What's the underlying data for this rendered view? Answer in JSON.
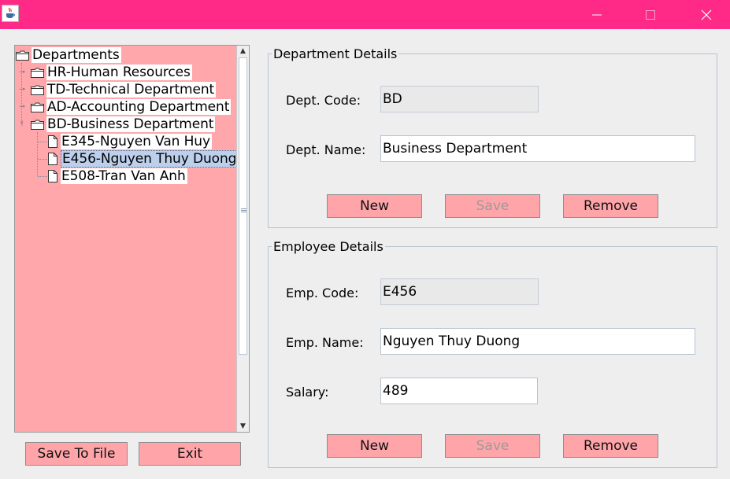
{
  "window": {
    "title": "",
    "icon": "java-cup-icon",
    "controls": [
      "minimize",
      "maximize",
      "close"
    ]
  },
  "tree": {
    "root_label": "Departments",
    "departments": [
      {
        "label": "HR-Human Resources",
        "expanded": false
      },
      {
        "label": "TD-Technical Department",
        "expanded": false
      },
      {
        "label": "AD-Accounting Department",
        "expanded": false
      },
      {
        "label": "BD-Business Department",
        "expanded": true
      }
    ],
    "employees": [
      {
        "label": "E345-Nguyen Van Huy",
        "selected": false
      },
      {
        "label": "E456-Nguyen Thuy Duong",
        "selected": true
      },
      {
        "label": "E508-Tran Van Anh",
        "selected": false
      }
    ]
  },
  "left_buttons": {
    "save_to_file": "Save To File",
    "exit": "Exit"
  },
  "department_details": {
    "title": "Department Details",
    "code_label": "Dept. Code:",
    "code_value": "BD",
    "name_label": "Dept. Name:",
    "name_value": "Business Department",
    "buttons": {
      "new": "New",
      "save": "Save",
      "remove": "Remove"
    }
  },
  "employee_details": {
    "title": "Employee Details",
    "code_label": "Emp. Code:",
    "code_value": "E456",
    "name_label": "Emp. Name:",
    "name_value": "Nguyen Thuy Duong",
    "salary_label": "Salary:",
    "salary_value": "489",
    "buttons": {
      "new": "New",
      "save": "Save",
      "remove": "Remove"
    }
  },
  "colors": {
    "title_bar": "#ff2a88",
    "tree_background": "#ffa7ab",
    "button_background": "#ffa5a9",
    "selection": "#bcd0ec"
  }
}
